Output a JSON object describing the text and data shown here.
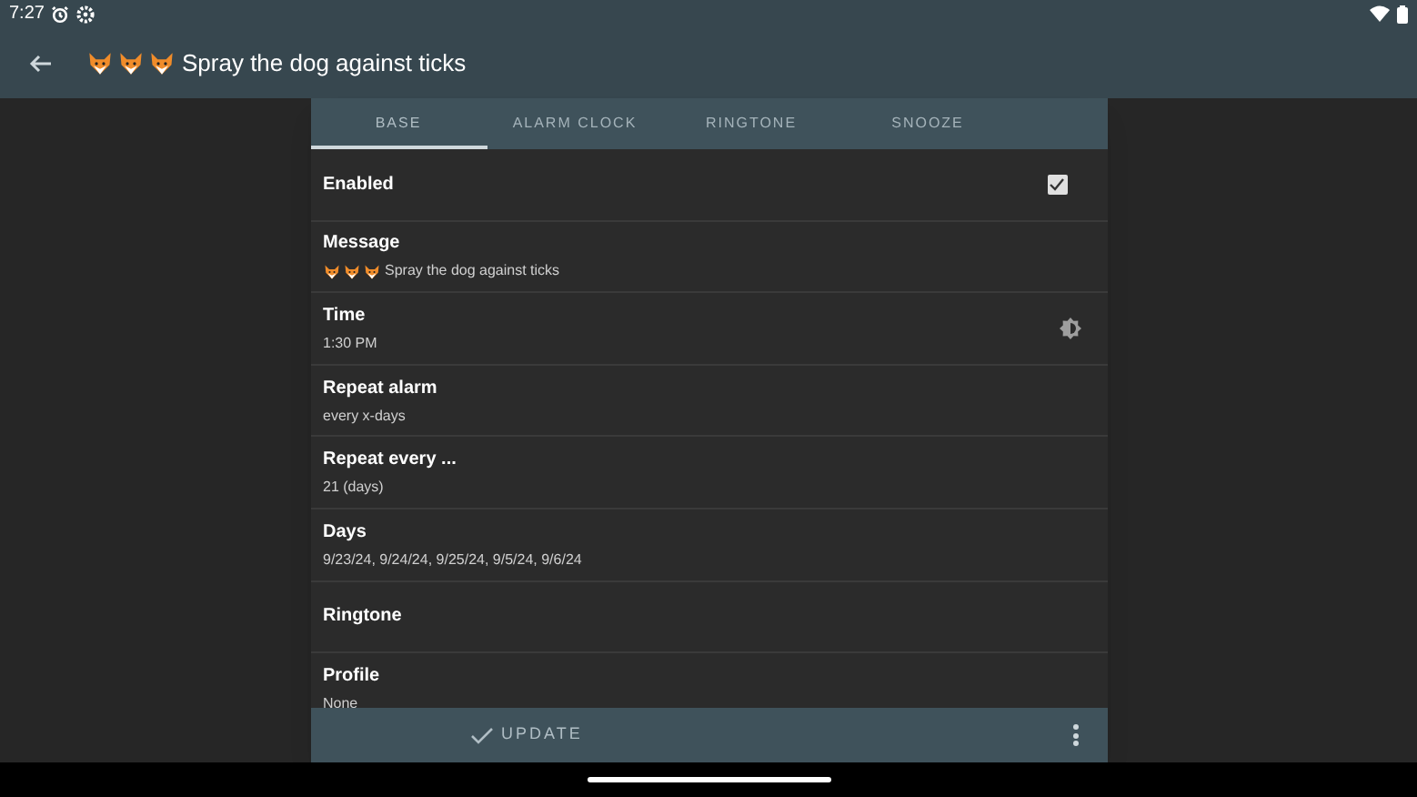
{
  "status_bar": {
    "time": "7:27"
  },
  "app_bar": {
    "title": "Spray the dog against ticks"
  },
  "tabs": [
    {
      "label": "BASE",
      "selected": true
    },
    {
      "label": "ALARM CLOCK",
      "selected": false
    },
    {
      "label": "RINGTONE",
      "selected": false
    },
    {
      "label": "SNOOZE",
      "selected": false
    }
  ],
  "settings": [
    {
      "kind": "checkbox",
      "title": "Enabled",
      "checked": true
    },
    {
      "kind": "message",
      "title": "Message",
      "value": "Spray the dog against ticks"
    },
    {
      "kind": "time",
      "title": "Time",
      "value": "1:30 PM"
    },
    {
      "kind": "text",
      "title": "Repeat alarm",
      "value": "every x-days"
    },
    {
      "kind": "text",
      "title": "Repeat every ...",
      "value": "21 (days)"
    },
    {
      "kind": "text",
      "title": "Days",
      "value": "9/23/24, 9/24/24, 9/25/24, 9/5/24, 9/6/24"
    },
    {
      "kind": "text",
      "title": "Ringtone"
    },
    {
      "kind": "text",
      "title": "Profile",
      "value": "None"
    }
  ],
  "bottom_bar": {
    "button": "UPDATE"
  }
}
